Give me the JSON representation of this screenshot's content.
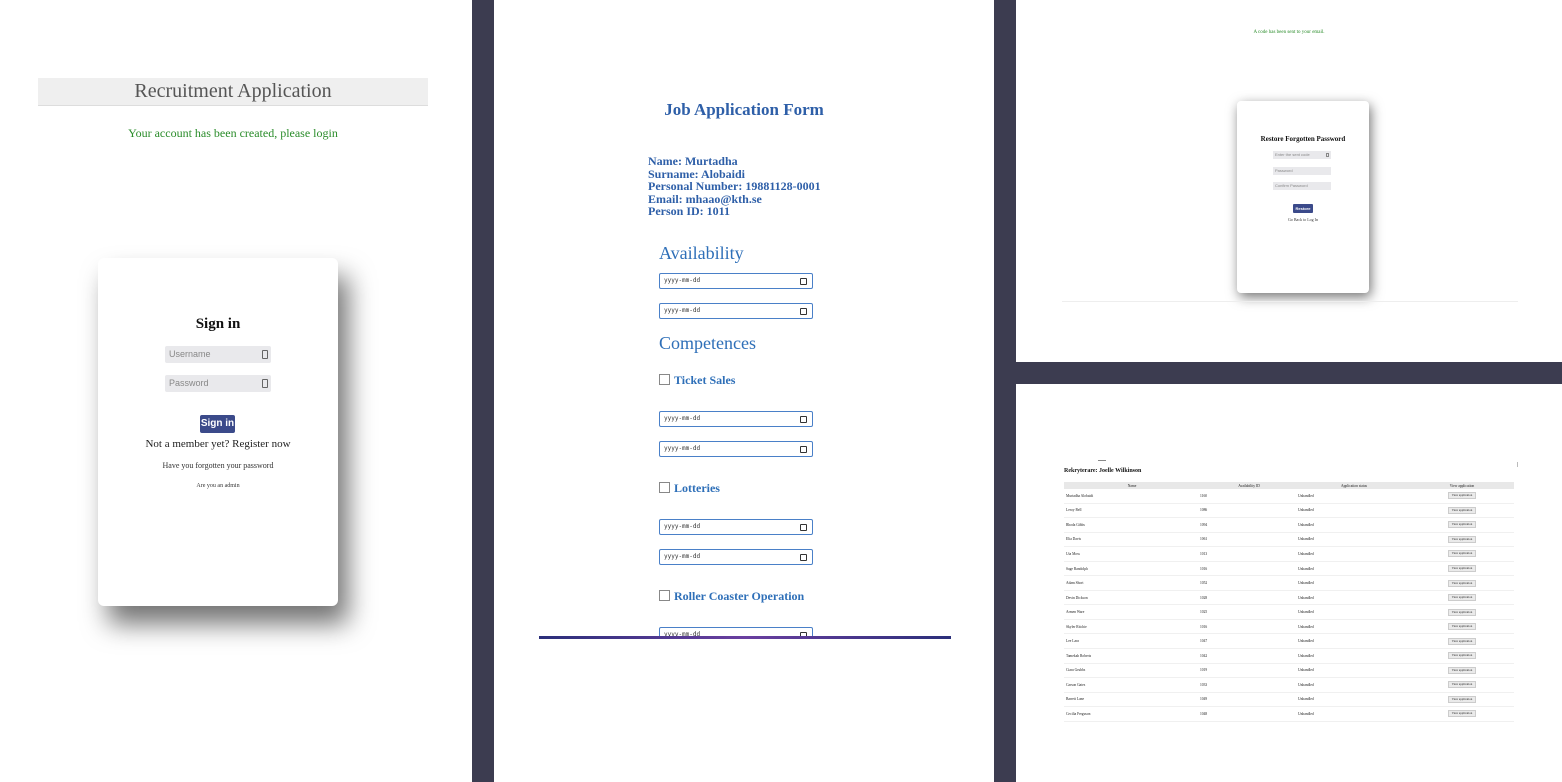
{
  "panel1": {
    "header_title": "Recruitment Application",
    "success_message": "Your account has been created, please login",
    "signin": {
      "title": "Sign in",
      "username_placeholder": "Username",
      "password_placeholder": "Password",
      "button_label": "Sign in",
      "register_text": "Not a member yet? Register now",
      "forgot_text": "Have you forgotten your password",
      "admin_text": "Are you an admin"
    }
  },
  "panel2": {
    "title": "Job Application Form",
    "info": {
      "name": "Name: Murtadha",
      "surname": "Surname: Alobaidi",
      "personal_number": "Personal Number: 19881128-0001",
      "email": "Email: mhaao@kth.se",
      "person_id": "Person ID: 1011"
    },
    "availability_heading": "Availability",
    "competences_heading": "Competences",
    "date_placeholder": "yyyy-mm-dd",
    "competences": [
      "Ticket Sales",
      "Lotteries",
      "Roller Coaster Operation"
    ]
  },
  "panel3": {
    "message": "A code has been sent to your email.",
    "title": "Restore Forgotten Password",
    "code_placeholder": "Enter the sent code",
    "password_placeholder": "Password",
    "confirm_placeholder": "Confirm Password",
    "button_label": "Restore",
    "back_link": "Go Back to Log In"
  },
  "panel4": {
    "recruiter": "Rekryterare: Joelle Wilkinson",
    "columns": [
      "Name",
      "Availability ID",
      "Application status",
      "View application"
    ],
    "view_label": "View application",
    "rows": [
      {
        "name": "Murtadha Alobaidi",
        "id": "1160",
        "status": "Unhandled"
      },
      {
        "name": "Leroy Bell",
        "id": "1086",
        "status": "Unhandled"
      },
      {
        "name": "Rhoda Gibbs",
        "id": "1094",
        "status": "Unhandled"
      },
      {
        "name": "Elia Davis",
        "id": "1061",
        "status": "Unhandled"
      },
      {
        "name": "Uta Moss",
        "id": "1013",
        "status": "Unhandled"
      },
      {
        "name": "Sage Randolph",
        "id": "1016",
        "status": "Unhandled"
      },
      {
        "name": "Adam Short",
        "id": "1052",
        "status": "Unhandled"
      },
      {
        "name": "Devin Dickson",
        "id": "1028",
        "status": "Unhandled"
      },
      {
        "name": "Armen Ware",
        "id": "1025",
        "status": "Unhandled"
      },
      {
        "name": "Skyler Ritchie",
        "id": "1016",
        "status": "Unhandled"
      },
      {
        "name": "Lee Lara",
        "id": "1047",
        "status": "Unhandled"
      },
      {
        "name": "Tamekah Roberts",
        "id": "1042",
        "status": "Unhandled"
      },
      {
        "name": "Ciara Grubbs",
        "id": "1019",
        "status": "Unhandled"
      },
      {
        "name": "Carson Gates",
        "id": "1033",
        "status": "Unhandled"
      },
      {
        "name": "Barrett Lane",
        "id": "1049",
        "status": "Unhandled"
      },
      {
        "name": "Cecilia Ferguson",
        "id": "1048",
        "status": "Unhandled"
      }
    ]
  }
}
